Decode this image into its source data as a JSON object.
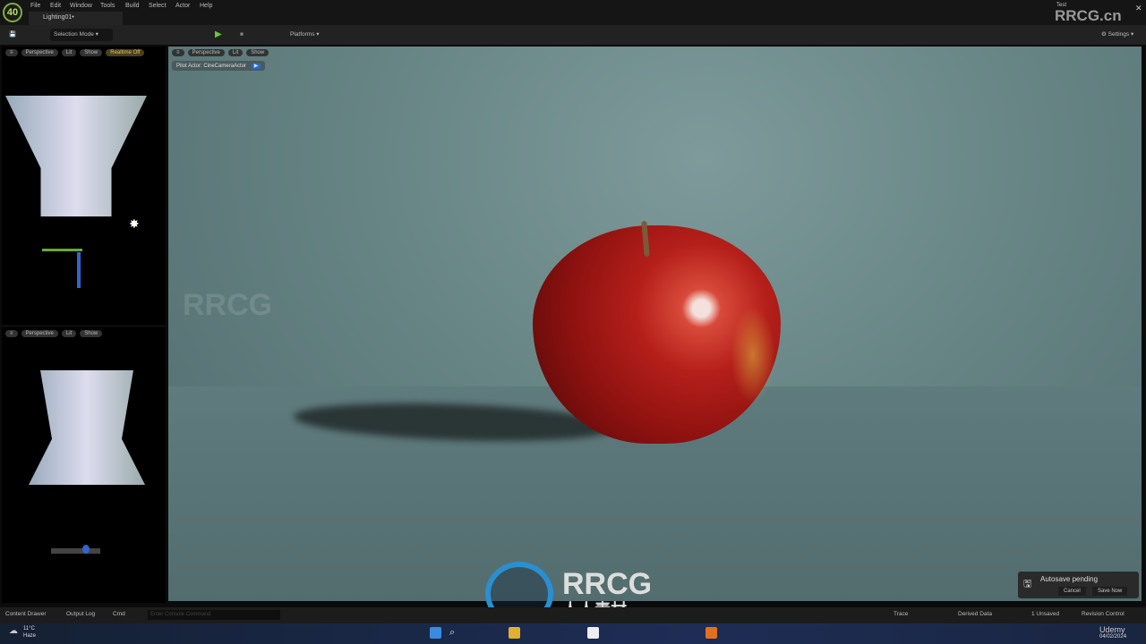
{
  "app": {
    "version_badge": "40",
    "tab": "Lighting01•",
    "project": "Test",
    "watermark": "RRCG.cn"
  },
  "menu": [
    "File",
    "Edit",
    "Window",
    "Tools",
    "Build",
    "Select",
    "Actor",
    "Help"
  ],
  "toolbar": {
    "mode": "Selection Mode",
    "platforms": "Platforms",
    "settings": "Settings"
  },
  "viewport_top": {
    "view": "Perspective",
    "lit": "Lit",
    "show": "Show",
    "realtime": "Realtime Off"
  },
  "viewport_bottom": {
    "view": "Perspective",
    "lit": "Lit",
    "show": "Show"
  },
  "viewport_main": {
    "view": "Perspective",
    "lit": "Lit",
    "show": "Show",
    "pilot": "Pilot Actor: CineCameraActor"
  },
  "autosave": {
    "title": "Autosave pending",
    "cancel": "Cancel",
    "save": "Save Now"
  },
  "statusbar": {
    "content_drawer": "Content Drawer",
    "output_log": "Output Log",
    "cmd": "Cmd",
    "console_placeholder": "Enter Console Command",
    "trace": "Trace",
    "derived": "Derived Data",
    "unsaved": "1 Unsaved",
    "revision": "Revision Control"
  },
  "taskbar": {
    "temp": "11°C",
    "weather": "Haze",
    "date": "04/02/2024"
  },
  "overlay": {
    "brand": "RRCG",
    "sub": "人人素材",
    "udemy": "Udemy"
  }
}
